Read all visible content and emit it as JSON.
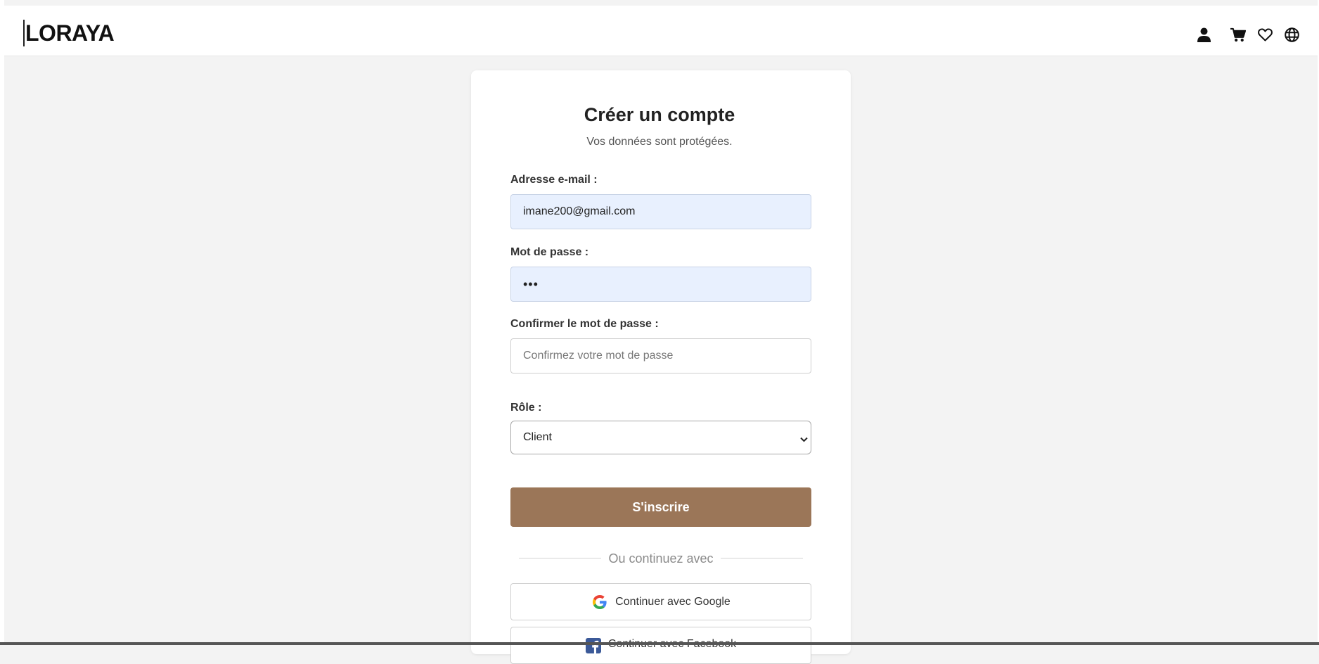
{
  "header": {
    "logo": "LORAYA",
    "icons": [
      "user-icon",
      "cart-icon",
      "heart-icon",
      "globe-icon"
    ]
  },
  "form": {
    "title": "Créer un compte",
    "subtitle": "Vos données sont protégées.",
    "email": {
      "label": "Adresse e-mail :",
      "value": "imane200@gmail.com"
    },
    "password": {
      "label": "Mot de passe :",
      "value": "•••"
    },
    "confirm": {
      "label": "Confirmer le mot de passe :",
      "placeholder": "Confirmez votre mot de passe"
    },
    "role": {
      "label": "Rôle :",
      "selected": "Client"
    },
    "submit_label": "S'inscrire",
    "divider_text": "Ou continuez avec",
    "google_label": "Continuer avec Google",
    "facebook_label": "Continuer avec Facebook"
  },
  "colors": {
    "accent": "#9b7658",
    "autofill": "#e8f0fe",
    "page_bg": "#f3f3f3"
  }
}
